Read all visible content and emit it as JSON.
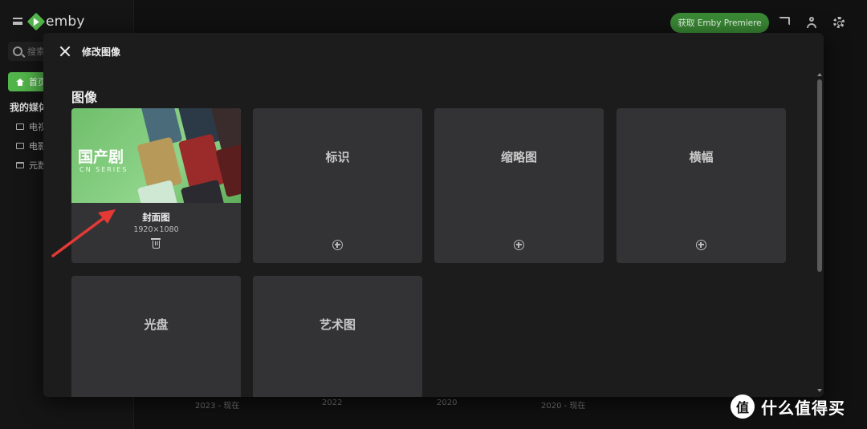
{
  "app": {
    "logo_text": "emby",
    "search_placeholder": "搜索",
    "home_label": "首页",
    "section_label": "我的媒体",
    "library_items": [
      "电视",
      "电影",
      "元数据"
    ],
    "premiere_button": "获取 Emby Premiere"
  },
  "background_years": [
    "2023 - 现在",
    "2022",
    "2020",
    "2020 - 现在"
  ],
  "modal": {
    "title": "修改图像",
    "section_title": "图像",
    "cover": {
      "image_title": "国产剧",
      "image_subtitle": "CN SERIES",
      "name": "封面图",
      "dimensions": "1920×1080"
    },
    "slots": [
      "标识",
      "缩略图",
      "横幅",
      "光盘",
      "艺术图"
    ]
  },
  "watermark": {
    "badge": "值",
    "text": "什么值得买"
  },
  "colors": {
    "accent": "#52b54b",
    "annotation_arrow": "#e53935"
  }
}
